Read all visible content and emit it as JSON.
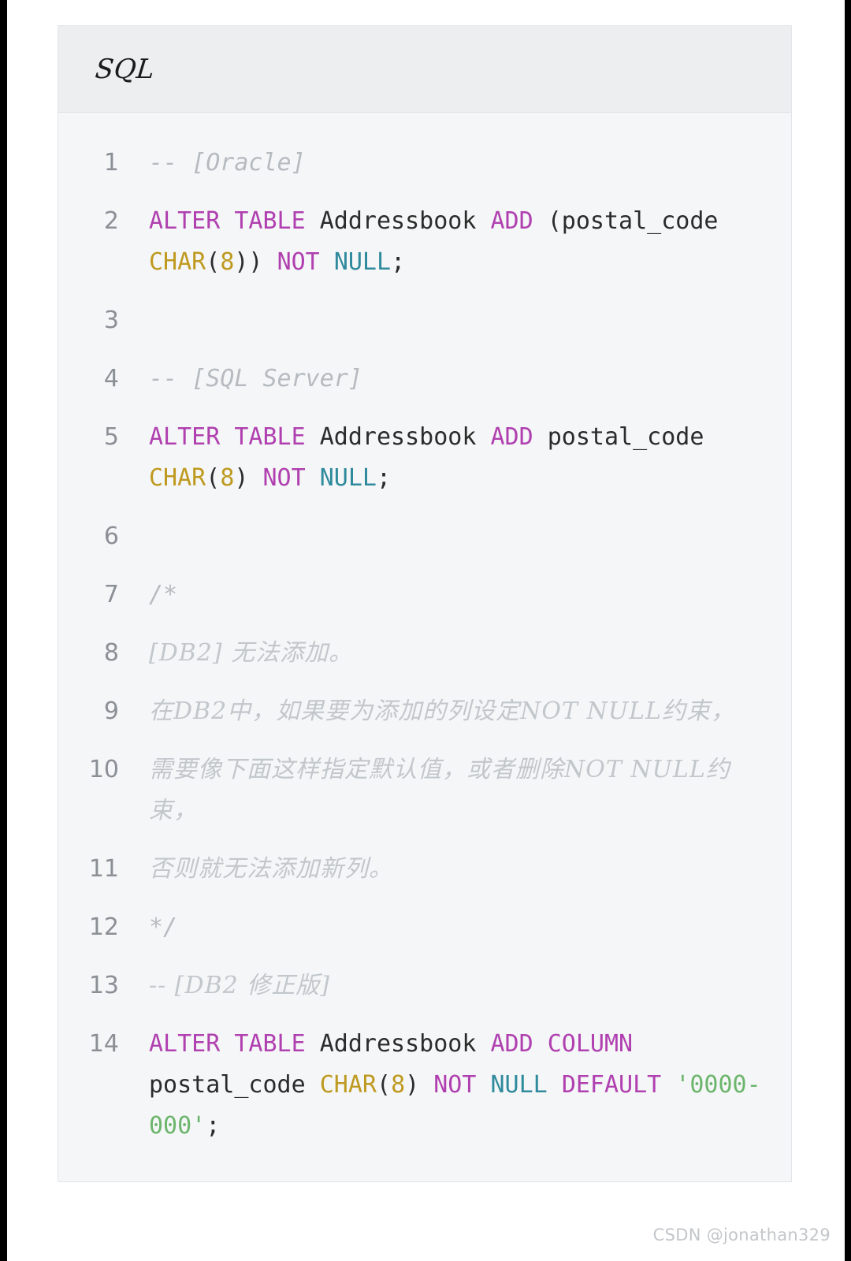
{
  "card": {
    "language_label": "SQL"
  },
  "code": {
    "lines": [
      {
        "number": "1",
        "kind": "comment",
        "text": "-- [Oracle]"
      },
      {
        "number": "2",
        "kind": "code",
        "text": "ALTER TABLE Addressbook ADD (postal_code CHAR(8)) NOT NULL;",
        "tokens": [
          {
            "t": "ALTER",
            "c": "kw"
          },
          {
            "t": " ",
            "c": "pun"
          },
          {
            "t": "TABLE",
            "c": "kw"
          },
          {
            "t": " ",
            "c": "pun"
          },
          {
            "t": "Addressbook",
            "c": "id"
          },
          {
            "t": " ",
            "c": "pun"
          },
          {
            "t": "ADD",
            "c": "kw"
          },
          {
            "t": " ",
            "c": "pun"
          },
          {
            "t": "(postal_code ",
            "c": "id"
          },
          {
            "t": "CHAR",
            "c": "typ"
          },
          {
            "t": "(",
            "c": "pun"
          },
          {
            "t": "8",
            "c": "num"
          },
          {
            "t": ")) ",
            "c": "pun"
          },
          {
            "t": "NOT",
            "c": "kw"
          },
          {
            "t": " ",
            "c": "pun"
          },
          {
            "t": "NULL",
            "c": "nul"
          },
          {
            "t": ";",
            "c": "pun"
          }
        ]
      },
      {
        "number": "3",
        "kind": "blank",
        "text": ""
      },
      {
        "number": "4",
        "kind": "comment",
        "text": "-- [SQL Server]"
      },
      {
        "number": "5",
        "kind": "code",
        "text": "ALTER TABLE Addressbook ADD postal_code CHAR(8) NOT NULL;",
        "tokens": [
          {
            "t": "ALTER",
            "c": "kw"
          },
          {
            "t": " ",
            "c": "pun"
          },
          {
            "t": "TABLE",
            "c": "kw"
          },
          {
            "t": " ",
            "c": "pun"
          },
          {
            "t": "Addressbook",
            "c": "id"
          },
          {
            "t": " ",
            "c": "pun"
          },
          {
            "t": "ADD",
            "c": "kw"
          },
          {
            "t": " ",
            "c": "pun"
          },
          {
            "t": "postal_code ",
            "c": "id"
          },
          {
            "t": "CHAR",
            "c": "typ"
          },
          {
            "t": "(",
            "c": "pun"
          },
          {
            "t": "8",
            "c": "num"
          },
          {
            "t": ") ",
            "c": "pun"
          },
          {
            "t": "NOT",
            "c": "kw"
          },
          {
            "t": " ",
            "c": "pun"
          },
          {
            "t": "NULL",
            "c": "nul"
          },
          {
            "t": ";",
            "c": "pun"
          }
        ]
      },
      {
        "number": "6",
        "kind": "blank",
        "text": ""
      },
      {
        "number": "7",
        "kind": "comment",
        "text": "/*"
      },
      {
        "number": "8",
        "kind": "comment-cn",
        "text": "[DB2] 无法添加。"
      },
      {
        "number": "9",
        "kind": "comment-cn",
        "text": "在DB2中，如果要为添加的列设定NOT NULL约束，"
      },
      {
        "number": "10",
        "kind": "comment-cn",
        "text": "需要像下面这样指定默认值，或者删除NOT NULL约束，"
      },
      {
        "number": "11",
        "kind": "comment-cn",
        "text": "否则就无法添加新列。"
      },
      {
        "number": "12",
        "kind": "comment",
        "text": "*/"
      },
      {
        "number": "13",
        "kind": "comment-cn",
        "text": "-- [DB2 修正版]"
      },
      {
        "number": "14",
        "kind": "code",
        "text": "ALTER TABLE Addressbook ADD COLUMN postal_code CHAR(8) NOT NULL DEFAULT '0000-000';",
        "tokens": [
          {
            "t": "ALTER",
            "c": "kw"
          },
          {
            "t": " ",
            "c": "pun"
          },
          {
            "t": "TABLE",
            "c": "kw"
          },
          {
            "t": " ",
            "c": "pun"
          },
          {
            "t": "Addressbook",
            "c": "id"
          },
          {
            "t": " ",
            "c": "pun"
          },
          {
            "t": "ADD",
            "c": "kw"
          },
          {
            "t": " ",
            "c": "pun"
          },
          {
            "t": "COLUMN",
            "c": "kw"
          },
          {
            "t": " ",
            "c": "pun"
          },
          {
            "t": "postal_code ",
            "c": "id"
          },
          {
            "t": "CHAR",
            "c": "typ"
          },
          {
            "t": "(",
            "c": "pun"
          },
          {
            "t": "8",
            "c": "num"
          },
          {
            "t": ") ",
            "c": "pun"
          },
          {
            "t": "NOT",
            "c": "kw"
          },
          {
            "t": " ",
            "c": "pun"
          },
          {
            "t": "NULL",
            "c": "nul"
          },
          {
            "t": " ",
            "c": "pun"
          },
          {
            "t": "DEFAULT",
            "c": "kw"
          },
          {
            "t": " ",
            "c": "pun"
          },
          {
            "t": "'0000-000'",
            "c": "str"
          },
          {
            "t": ";",
            "c": "pun"
          }
        ]
      }
    ]
  },
  "watermark": {
    "text": "CSDN @jonathan329"
  },
  "colors": {
    "keyword": "#b040b0",
    "type": "#bf9a20",
    "number": "#bf9a20",
    "null_literal": "#2e8a9c",
    "string": "#6cb56c",
    "comment": "#b6bbc0",
    "identifier": "#2b2b2b",
    "line_number": "#8b9096",
    "card_background": "#f5f6f7",
    "header_background": "#eceef0",
    "page_background": "#ffffff"
  }
}
